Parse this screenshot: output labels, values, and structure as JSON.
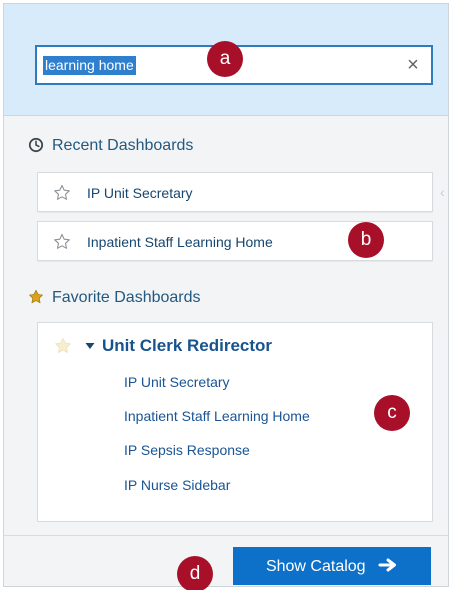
{
  "search": {
    "value": "learning home",
    "clear_icon": "close-icon"
  },
  "recent": {
    "title": "Recent Dashboards",
    "icon": "clock-icon",
    "items": [
      {
        "label": "IP Unit Secretary",
        "icon": "star-outline-icon"
      },
      {
        "label": "Inpatient Staff Learning Home",
        "icon": "star-outline-icon"
      }
    ]
  },
  "favorite": {
    "title": "Favorite Dashboards",
    "icon": "star-filled-icon",
    "group": {
      "title": "Unit Clerk Redirector",
      "icon": "star-filled-icon",
      "items": [
        "IP Unit Secretary",
        "Inpatient Staff Learning Home",
        "IP Sepsis Response",
        "IP Nurse Sidebar"
      ]
    }
  },
  "footer": {
    "catalog_button": "Show Catalog",
    "catalog_icon": "arrow-right-icon"
  },
  "annotations": [
    "a",
    "b",
    "c",
    "d"
  ],
  "colors": {
    "accent": "#0d71c9",
    "header_bg": "#d7ebfb",
    "marker": "#a8102a"
  }
}
